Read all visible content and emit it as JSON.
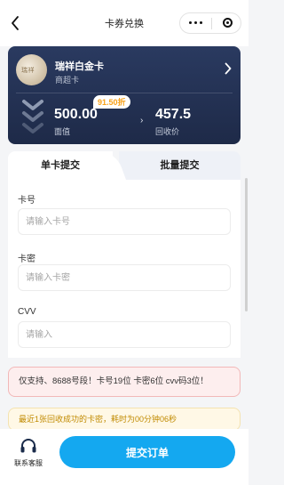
{
  "nav": {
    "title": "卡券兑换"
  },
  "card": {
    "thumb_text": "瑞祥",
    "name": "瑞祥白金卡",
    "subtitle": "商超卡",
    "discount_badge": "91.50折",
    "face_value": "500.00",
    "face_label": "面值",
    "arrow_glyph": "›",
    "recycle_value": "457.5",
    "recycle_label": "回收价"
  },
  "tabs": {
    "single": "单卡提交",
    "batch": "批量提交"
  },
  "form": {
    "card_no_label": "卡号",
    "card_no_placeholder": "请输入卡号",
    "card_pwd_label": "卡密",
    "card_pwd_placeholder": "请输入卡密",
    "cvv_label": "CVV",
    "cvv_placeholder": "请输入"
  },
  "notice": "仅支持、8688号段！卡号19位 卡密6位 cvv码3位！",
  "recent": "最近1张回收成功的卡密，耗时为00分钟06秒",
  "bottom": {
    "support_label": "联系客服",
    "submit_label": "提交订单"
  },
  "colors": {
    "accent": "#14a8f0",
    "card_bg": "#1e2a48",
    "badge": "#f7a11a",
    "notice_bg": "#fdeeee",
    "recent_text": "#c08a00"
  }
}
